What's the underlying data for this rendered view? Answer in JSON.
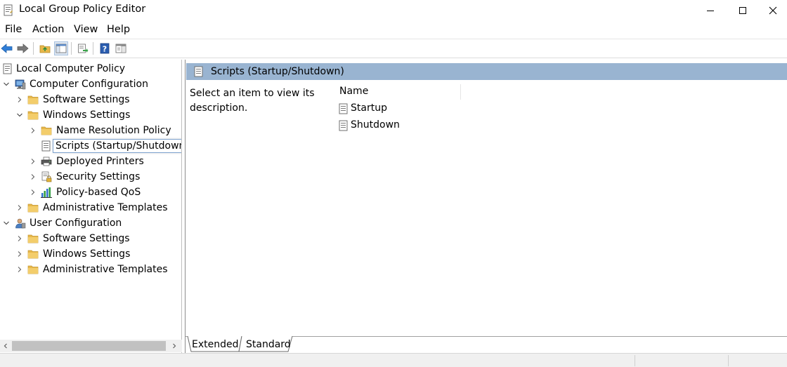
{
  "window": {
    "title": "Local Group Policy Editor",
    "icon": "policy-document-icon",
    "controls": [
      "minimize-icon",
      "maximize-icon",
      "close-icon"
    ]
  },
  "menu": {
    "items": [
      "File",
      "Action",
      "View",
      "Help"
    ]
  },
  "toolbar": {
    "buttons": [
      "back-arrow-icon",
      "forward-arrow-icon",
      "up-folder-icon",
      "show-hide-tree-icon",
      "export-list-icon",
      "help-icon",
      "properties-pane-icon"
    ]
  },
  "tree": {
    "root": "Local Computer Policy",
    "computer_config": "Computer Configuration",
    "cc_software": "Software Settings",
    "cc_windows": "Windows Settings",
    "name_resolution": "Name Resolution Policy",
    "scripts": "Scripts (Startup/Shutdown)",
    "printers": "Deployed Printers",
    "security": "Security Settings",
    "qos": "Policy-based QoS",
    "cc_admin": "Administrative Templates",
    "user_config": "User Configuration",
    "uc_software": "Software Settings",
    "uc_windows": "Windows Settings",
    "uc_admin": "Administrative Templates"
  },
  "details": {
    "header": "Scripts (Startup/Shutdown)",
    "description": "Select an item to view its description.",
    "column_name": "Name",
    "items": [
      "Startup",
      "Shutdown"
    ]
  },
  "tabs": {
    "extended": "Extended",
    "standard": "Standard"
  },
  "colors": {
    "header_bar": "#99b4d1",
    "folder": "#e8b84a",
    "selection_border": "#7da2ce"
  }
}
